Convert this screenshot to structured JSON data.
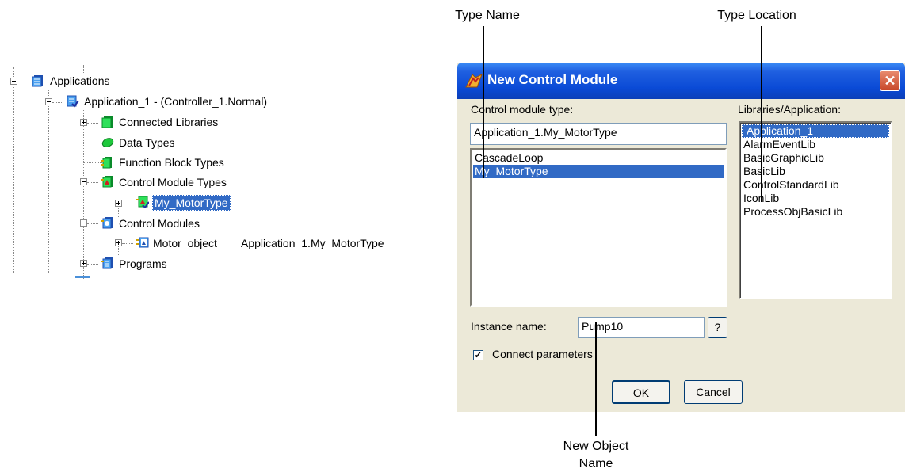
{
  "callouts": {
    "type_name": "Type Name",
    "type_location": "Type Location",
    "new_object_name": "New Object\nName"
  },
  "tree": {
    "root": "Applications",
    "application": "Application_1 - (Controller_1.Normal)",
    "connected_libraries": "Connected Libraries",
    "data_types": "Data Types",
    "function_block_types": "Function Block Types",
    "control_module_types": "Control Module Types",
    "my_motortype": "My_MotorType",
    "control_modules": "Control Modules",
    "motor_object": "Motor_object",
    "motor_object_type": "Application_1.My_MotorType",
    "programs": "Programs"
  },
  "dialog": {
    "title": "New Control Module",
    "close_glyph": "✕",
    "control_module_type_label": "Control module type:",
    "control_module_type_value": "Application_1.My_MotorType",
    "type_list": [
      "CascadeLoop",
      "My_MotorType"
    ],
    "type_list_selected": "My_MotorType",
    "libraries_label": "Libraries/Application:",
    "libraries": [
      "Application_1",
      "AlarmEventLib",
      "BasicGraphicLib",
      "BasicLib",
      "ControlStandardLib",
      "IconLib",
      "ProcessObjBasicLib"
    ],
    "libraries_selected": "Application_1",
    "instance_name_label": "Instance name:",
    "instance_name_value": "Pump10",
    "help_button": "?",
    "connect_parameters_label": "Connect parameters",
    "connect_parameters_checked": true,
    "ok_button": "OK",
    "cancel_button": "Cancel"
  },
  "colors": {
    "selection": "#316ac5",
    "titlebar": "#0a4ad6",
    "dialog_face": "#ece9d8"
  }
}
